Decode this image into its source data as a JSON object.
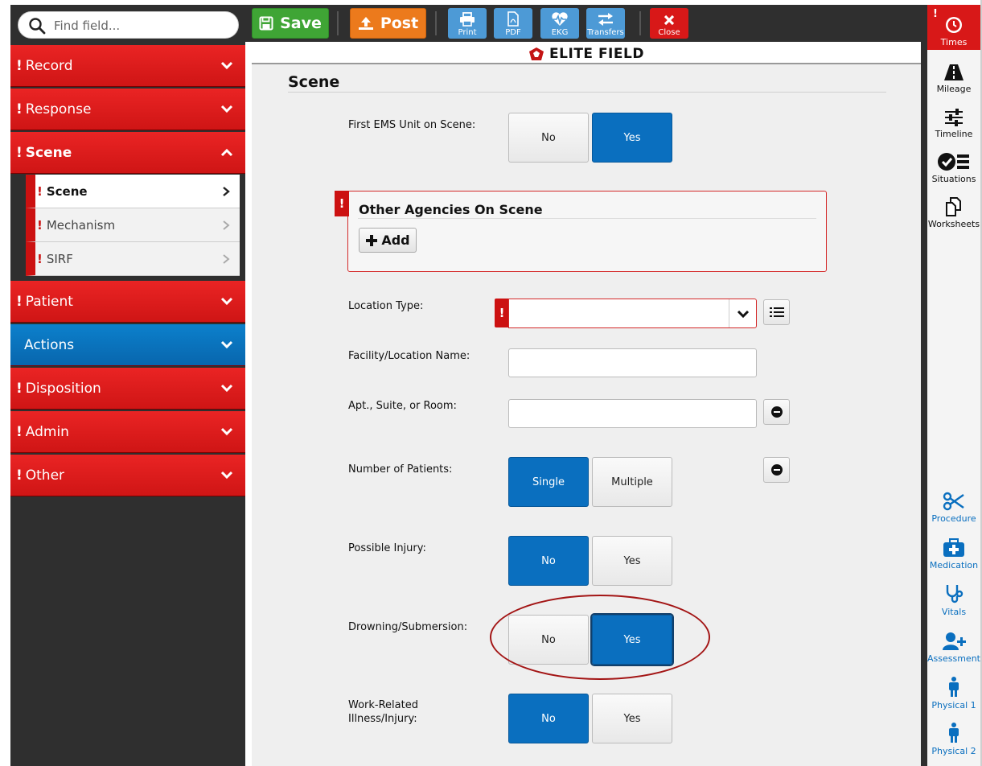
{
  "search": {
    "placeholder": "Find field..."
  },
  "sidebar": {
    "sections": [
      {
        "label": "Record",
        "required": true
      },
      {
        "label": "Response",
        "required": true
      },
      {
        "label": "Scene",
        "required": true,
        "open": true
      },
      {
        "label": "Patient",
        "required": true
      },
      {
        "label": "Actions",
        "required": false
      },
      {
        "label": "Disposition",
        "required": true
      },
      {
        "label": "Admin",
        "required": true
      },
      {
        "label": "Other",
        "required": true
      }
    ],
    "scene_sub": [
      {
        "label": "Scene",
        "active": true
      },
      {
        "label": "Mechanism"
      },
      {
        "label": "SIRF"
      }
    ],
    "required_mark": "!"
  },
  "toolbar": {
    "save_label": "Save",
    "post_label": "Post",
    "print_label": "Print",
    "pdf_label": "PDF",
    "ekg_label": "EKG",
    "transfers_label": "Transfers",
    "close_label": "Close"
  },
  "brand": {
    "name": "ELITE FIELD"
  },
  "form": {
    "title": "Scene",
    "first_unit": {
      "label": "First EMS Unit on Scene:",
      "options": [
        "No",
        "Yes"
      ],
      "selected": "Yes"
    },
    "agencies": {
      "title": "Other Agencies On Scene",
      "add_label": "Add"
    },
    "location_type": {
      "label": "Location Type:",
      "value": ""
    },
    "facility_name": {
      "label": "Facility/Location Name:",
      "value": ""
    },
    "apt_suite": {
      "label": "Apt., Suite, or Room:",
      "value": ""
    },
    "num_patients": {
      "label": "Number of Patients:",
      "options": [
        "Single",
        "Multiple"
      ],
      "selected": "Single"
    },
    "possible_injury": {
      "label": "Possible Injury:",
      "options": [
        "No",
        "Yes"
      ],
      "selected": "No"
    },
    "drowning": {
      "label": "Drowning/Submersion:",
      "options": [
        "No",
        "Yes"
      ],
      "selected": "Yes"
    },
    "work_related": {
      "label_line1": "Work-Related",
      "label_line2": "Illness/Injury:",
      "options": [
        "No",
        "Yes"
      ],
      "selected": "No"
    }
  },
  "rightbar": {
    "times": "Times",
    "mileage": "Mileage",
    "timeline": "Timeline",
    "situations": "Situations",
    "worksheets": "Worksheets",
    "procedure": "Procedure",
    "medication": "Medication",
    "vitals": "Vitals",
    "assessment": "Assessment",
    "physical1": "Physical 1",
    "physical2": "Physical 2"
  },
  "colors": {
    "accent_red": "#d81818",
    "accent_blue": "#0a6fbf",
    "save_green": "#3fa535",
    "post_orange": "#ec7a1c",
    "tool_blue": "#4d9ad6"
  }
}
